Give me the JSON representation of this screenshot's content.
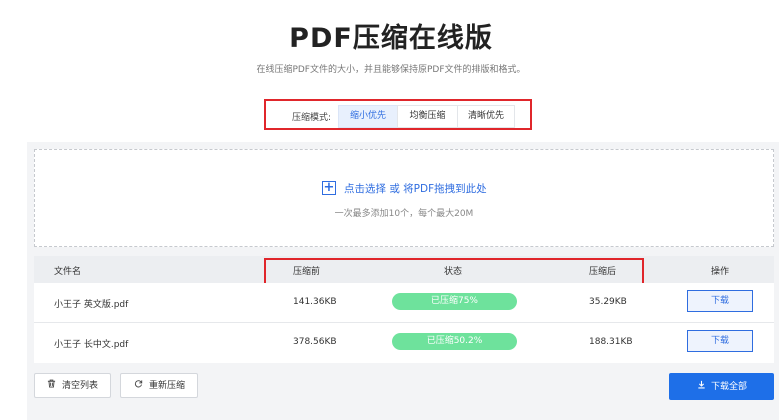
{
  "header": {
    "title": "PDF压缩在线版",
    "subtitle": "在线压缩PDF文件的大小，并且能够保持原PDF文件的排版和格式。"
  },
  "mode": {
    "label": "压缩模式:",
    "options": [
      "缩小优先",
      "均衡压缩",
      "清晰优先"
    ],
    "selected": "缩小优先"
  },
  "upload": {
    "plus": "+",
    "text": "点击选择 或 将PDF拖拽到此处",
    "hint": "一次最多添加10个，每个最大20M"
  },
  "table": {
    "headers": [
      "文件名",
      "压缩前",
      "状态",
      "压缩后",
      "操作"
    ],
    "rows": [
      {
        "name": "小王子 英文版.pdf",
        "before": "141.36KB",
        "status": "已压缩75%",
        "after": "35.29KB",
        "action": "下载"
      },
      {
        "name": "小王子 长中文.pdf",
        "before": "378.56KB",
        "status": "已压缩50.2%",
        "after": "188.31KB",
        "action": "下载"
      }
    ]
  },
  "footer": {
    "clear": "清空列表",
    "recompress": "重新压缩",
    "download_all": "下载全部"
  },
  "icons": {
    "clear": "trash-icon",
    "recompress": "refresh-icon",
    "download_all": "download-icon"
  },
  "colors": {
    "accent": "#2f6de0",
    "primary_button": "#1e6fe8",
    "status_pill": "#6ee29c",
    "highlight_border": "#e0262b"
  }
}
